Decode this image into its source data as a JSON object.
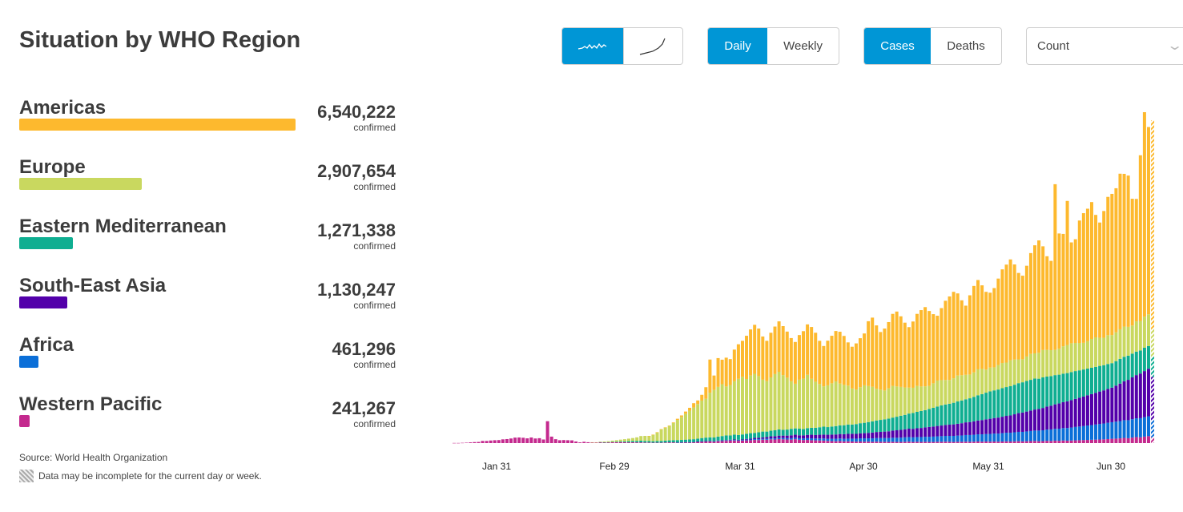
{
  "title": "Situation by WHO Region",
  "controls": {
    "chart_style": [
      {
        "icon": "daily-wave-icon",
        "active": true
      },
      {
        "icon": "cumulative-curve-icon",
        "active": false
      }
    ],
    "period": [
      {
        "label": "Daily",
        "active": true
      },
      {
        "label": "Weekly",
        "active": false
      }
    ],
    "metric": [
      {
        "label": "Cases",
        "active": true
      },
      {
        "label": "Deaths",
        "active": false
      }
    ],
    "scale_select": {
      "value": "Count"
    }
  },
  "regions": [
    {
      "name": "Americas",
      "value": "6,540,222",
      "count": 6540222,
      "sub": "confirmed",
      "color": "#FDB92E"
    },
    {
      "name": "Europe",
      "value": "2,907,654",
      "count": 2907654,
      "sub": "confirmed",
      "color": "#C9D85F"
    },
    {
      "name": "Eastern Mediterranean",
      "value": "1,271,338",
      "count": 1271338,
      "sub": "confirmed",
      "color": "#0FAE91"
    },
    {
      "name": "South-East Asia",
      "value": "1,130,247",
      "count": 1130247,
      "sub": "confirmed",
      "color": "#5300AA"
    },
    {
      "name": "Africa",
      "value": "461,296",
      "count": 461296,
      "sub": "confirmed",
      "color": "#0B6FD8"
    },
    {
      "name": "Western Pacific",
      "value": "241,267",
      "count": 241267,
      "sub": "confirmed",
      "color": "#C4298E"
    }
  ],
  "source": "Source: World Health Organization",
  "note": "Data may be incomplete for the current day or week.",
  "chart_data": {
    "type": "bar",
    "stacked": true,
    "x_start": "2020-01-20",
    "x_end": "2020-07-10",
    "x_ticks": [
      "Jan 31",
      "Feb 29",
      "Mar 31",
      "Apr 30",
      "May 31",
      "Jun 30"
    ],
    "incomplete_last": true,
    "grid": false,
    "series": [
      {
        "name": "Western Pacific",
        "color": "#C4298E",
        "values": [
          0.1,
          0.1,
          0.2,
          0.3,
          0.5,
          0.7,
          0.8,
          1.5,
          1.5,
          1.8,
          2.0,
          2.1,
          2.6,
          2.8,
          3.2,
          3.8,
          3.9,
          3.7,
          3.3,
          3.9,
          3.2,
          3.4,
          2.5,
          15.2,
          4.5,
          2.7,
          2.0,
          2.1,
          2.0,
          1.9,
          1.1,
          0.5,
          0.9,
          0.6,
          0.5,
          0.4,
          0.6,
          0.5,
          0.5,
          0.6,
          0.6,
          0.7,
          0.6,
          0.5,
          0.6,
          0.5,
          0.5,
          0.4,
          0.4,
          0.3,
          0.3,
          0.3,
          0.4,
          0.5,
          0.5,
          0.4,
          0.5,
          0.6,
          0.6,
          0.7,
          0.9,
          1.0,
          1.1,
          1.2,
          1.0,
          1.3,
          1.4,
          1.6,
          1.7,
          1.8,
          1.6,
          1.7,
          1.9,
          2.0,
          2.2,
          2.1,
          2.4,
          2.3,
          2.6,
          2.5,
          2.8,
          2.6,
          2.5,
          2.4,
          2.7,
          2.3,
          2.1,
          2.2,
          2.0,
          1.9,
          1.8,
          1.7,
          1.5,
          1.4,
          1.3,
          1.4,
          1.2,
          1.2,
          1.1,
          1.0,
          1.1,
          1.0,
          1.0,
          0.9,
          1.0,
          0.9,
          0.9,
          0.8,
          0.9,
          0.8,
          0.8,
          0.9,
          1.0,
          0.8,
          0.9,
          0.8,
          0.9,
          0.8,
          0.8,
          0.9,
          0.9,
          1.0,
          0.9,
          0.8,
          0.9,
          0.9,
          1.0,
          0.9,
          1.0,
          1.1,
          1.0,
          1.1,
          1.0,
          1.1,
          1.0,
          1.1,
          1.2,
          1.1,
          1.2,
          1.3,
          1.2,
          1.3,
          1.4,
          1.5,
          1.3,
          1.4,
          1.6,
          1.5,
          1.7,
          1.6,
          1.8,
          1.7,
          1.8,
          1.9,
          2.0,
          2.1,
          2.2,
          2.3,
          2.4,
          2.5,
          2.6,
          2.8,
          3.0,
          3.1,
          3.3,
          3.6,
          3.4,
          3.8,
          4.2,
          4.0,
          4.5,
          4.8,
          4.0
        ]
      },
      {
        "name": "Africa",
        "color": "#0B6FD8",
        "values": [
          0,
          0,
          0,
          0,
          0,
          0,
          0,
          0,
          0,
          0,
          0,
          0,
          0,
          0,
          0,
          0,
          0,
          0,
          0,
          0,
          0,
          0,
          0,
          0,
          0,
          0,
          0,
          0,
          0,
          0,
          0,
          0,
          0,
          0,
          0,
          0,
          0,
          0,
          0,
          0,
          0,
          0,
          0,
          0,
          0,
          0,
          0,
          0,
          0,
          0,
          0,
          0,
          0,
          0,
          0,
          0.1,
          0.1,
          0.1,
          0.1,
          0.1,
          0.1,
          0.2,
          0.2,
          0.2,
          0.2,
          0.3,
          0.3,
          0.3,
          0.3,
          0.4,
          0.4,
          0.4,
          0.5,
          0.5,
          0.6,
          0.6,
          0.6,
          0.7,
          0.7,
          0.8,
          0.8,
          0.9,
          0.9,
          1.0,
          1.0,
          1.1,
          1.1,
          1.2,
          1.3,
          1.3,
          1.4,
          1.5,
          1.5,
          1.6,
          1.7,
          1.8,
          1.8,
          1.9,
          2.0,
          2.1,
          2.2,
          2.3,
          2.3,
          2.4,
          2.5,
          2.6,
          2.6,
          2.7,
          2.8,
          2.9,
          3.0,
          3.1,
          3.2,
          3.2,
          3.3,
          3.4,
          3.5,
          3.6,
          3.7,
          3.8,
          3.9,
          4.0,
          4.1,
          4.2,
          4.3,
          4.4,
          4.6,
          4.7,
          4.8,
          5.0,
          5.1,
          5.2,
          5.4,
          5.5,
          5.6,
          5.8,
          6.0,
          6.1,
          6.3,
          6.5,
          6.6,
          6.8,
          7.0,
          7.2,
          7.4,
          7.5,
          7.8,
          8.0,
          8.2,
          8.4,
          8.6,
          8.8,
          9.0,
          9.3,
          9.5,
          9.7,
          10.0,
          10.2,
          10.5,
          10.8,
          11.0,
          11.3,
          11.5,
          11.8,
          12.0,
          12.3,
          12.5,
          12.8,
          13.0,
          13.3,
          13.5,
          13.8,
          12.0
        ]
      },
      {
        "name": "South-East Asia",
        "color": "#5300AA",
        "values": [
          0,
          0,
          0,
          0,
          0,
          0,
          0,
          0,
          0,
          0,
          0,
          0,
          0,
          0,
          0,
          0,
          0,
          0,
          0,
          0,
          0,
          0,
          0,
          0,
          0,
          0,
          0,
          0,
          0,
          0,
          0,
          0,
          0,
          0,
          0,
          0,
          0,
          0,
          0,
          0,
          0,
          0,
          0,
          0,
          0,
          0,
          0,
          0,
          0,
          0,
          0,
          0,
          0,
          0,
          0,
          0,
          0,
          0,
          0,
          0,
          0.1,
          0.1,
          0.1,
          0.1,
          0.1,
          0.2,
          0.2,
          0.2,
          0.3,
          0.3,
          0.3,
          0.4,
          0.5,
          0.6,
          0.8,
          0.9,
          1.0,
          1.2,
          1.4,
          1.5,
          1.6,
          1.7,
          1.8,
          2.0,
          2.1,
          2.0,
          2.2,
          2.3,
          2.5,
          2.4,
          2.6,
          2.7,
          2.8,
          2.9,
          3.0,
          3.1,
          3.2,
          3.3,
          3.4,
          3.3,
          3.5,
          3.6,
          3.8,
          4.0,
          4.2,
          4.3,
          4.5,
          4.7,
          5.0,
          5.2,
          5.4,
          5.6,
          5.8,
          5.9,
          6.1,
          6.3,
          6.5,
          6.8,
          7.0,
          7.2,
          7.4,
          7.6,
          7.8,
          8.0,
          8.2,
          8.5,
          8.8,
          9.0,
          9.3,
          9.6,
          9.9,
          10.2,
          10.5,
          10.8,
          11.1,
          11.4,
          11.7,
          12.0,
          12.5,
          13.0,
          13.4,
          13.8,
          14.2,
          14.6,
          15.0,
          15.5,
          16.0,
          16.5,
          17.0,
          17.5,
          18.0,
          18.5,
          19.0,
          19.5,
          20.0,
          20.5,
          21.0,
          21.5,
          22.0,
          22.5,
          23.0,
          23.5,
          24.0,
          25.0,
          26.0,
          27.0,
          28.0,
          29.0,
          30.0,
          31.0,
          32.0,
          33.0,
          30.0
        ]
      },
      {
        "name": "Eastern Mediterranean",
        "color": "#0FAE91",
        "values": [
          0,
          0,
          0,
          0,
          0,
          0,
          0,
          0,
          0,
          0,
          0,
          0,
          0,
          0,
          0,
          0,
          0,
          0,
          0,
          0,
          0,
          0,
          0,
          0,
          0,
          0,
          0,
          0,
          0,
          0,
          0,
          0,
          0,
          0,
          0,
          0,
          0.1,
          0.1,
          0.2,
          0.3,
          0.4,
          0.5,
          0.6,
          0.8,
          0.9,
          1.0,
          1.2,
          1.1,
          1.0,
          1.0,
          1.1,
          1.2,
          1.3,
          1.4,
          1.5,
          1.6,
          1.6,
          1.7,
          1.8,
          1.9,
          2.0,
          2.2,
          2.4,
          2.5,
          2.6,
          2.7,
          3.0,
          3.2,
          3.0,
          3.4,
          3.3,
          3.5,
          3.6,
          3.8,
          3.5,
          3.9,
          4.0,
          3.8,
          3.9,
          4.1,
          4.3,
          4.0,
          4.2,
          4.5,
          4.4,
          4.6,
          4.3,
          4.7,
          4.8,
          5.0,
          5.2,
          5.5,
          5.3,
          5.6,
          5.8,
          6.0,
          6.2,
          6.5,
          6.4,
          6.8,
          7.0,
          7.2,
          7.5,
          7.8,
          8.0,
          8.3,
          8.5,
          8.8,
          9.0,
          9.4,
          9.8,
          10.0,
          10.5,
          11.0,
          11.4,
          11.8,
          12.0,
          12.5,
          13.0,
          13.5,
          14.0,
          14.2,
          14.5,
          15.0,
          15.5,
          15.8,
          16.0,
          16.5,
          17.0,
          17.5,
          18.0,
          18.5,
          19.0,
          19.2,
          19.5,
          19.8,
          20.0,
          20.3,
          20.5,
          20.8,
          21.0,
          21.2,
          21.3,
          21.5,
          21.0,
          21.2,
          20.8,
          20.5,
          20.3,
          20.0,
          19.8,
          19.6,
          19.5,
          19.3,
          19.0,
          18.8,
          18.5,
          18.3,
          18.0,
          17.8,
          17.5,
          17.3,
          17.0,
          17.0,
          17.2,
          17.0,
          16.8,
          16.5,
          16.3,
          16.0,
          16.2,
          15.8,
          14.0
        ]
      },
      {
        "name": "Europe",
        "color": "#C9D85F",
        "values": [
          0,
          0,
          0,
          0,
          0,
          0,
          0,
          0,
          0,
          0,
          0,
          0,
          0,
          0,
          0,
          0,
          0,
          0,
          0,
          0,
          0,
          0,
          0,
          0,
          0,
          0,
          0,
          0,
          0,
          0,
          0,
          0,
          0,
          0,
          0.1,
          0.2,
          0.3,
          0.5,
          0.6,
          0.8,
          1.0,
          1.2,
          1.5,
          1.8,
          2.0,
          2.5,
          3.2,
          3.5,
          3.5,
          4.5,
          6.0,
          8.0,
          9.0,
          10.0,
          12.0,
          14.0,
          16.0,
          18.0,
          20.0,
          22.0,
          24.0,
          26.0,
          27.0,
          31.0,
          33.0,
          34.5,
          36.0,
          34.0,
          35.0,
          37.0,
          39.0,
          40.0,
          38.0,
          40.0,
          41.0,
          39.0,
          36.0,
          35.0,
          37.0,
          39.0,
          40.0,
          38.0,
          36.0,
          33.0,
          31.0,
          34.0,
          35.0,
          37.0,
          34.0,
          32.0,
          30.0,
          28.0,
          29.0,
          30.0,
          31.0,
          29.0,
          28.0,
          27.0,
          25.0,
          24.0,
          25.0,
          26.0,
          25.0,
          24.0,
          22.0,
          21.0,
          20.0,
          21.0,
          22.0,
          21.0,
          20.0,
          19.0,
          18.0,
          17.5,
          18.0,
          17.0,
          16.5,
          16.0,
          17.0,
          18.0,
          17.5,
          17.0,
          16.5,
          17.0,
          18.0,
          17.5,
          17.0,
          16.5,
          17.0,
          18.0,
          17.5,
          16.0,
          16.5,
          16.0,
          17.0,
          17.5,
          17.0,
          18.0,
          17.5,
          16.5,
          16.0,
          17.0,
          18.0,
          17.5,
          18.0,
          19.0,
          18.5,
          18.0,
          17.5,
          18.0,
          19.0,
          19.5,
          20.0,
          19.5,
          19.0,
          18.5,
          19.0,
          20.0,
          20.5,
          19.5,
          19.0,
          20.0,
          19.5,
          20.0,
          20.5,
          21.0,
          20.0,
          19.5,
          21.0,
          20.5,
          21.5,
          22.0,
          19.0
        ]
      },
      {
        "name": "Americas",
        "color": "#FDB92E",
        "values": [
          0,
          0,
          0,
          0,
          0,
          0,
          0,
          0,
          0,
          0,
          0,
          0,
          0,
          0,
          0,
          0,
          0,
          0,
          0,
          0,
          0,
          0,
          0,
          0,
          0,
          0,
          0,
          0,
          0,
          0,
          0,
          0,
          0,
          0,
          0,
          0,
          0,
          0,
          0,
          0,
          0,
          0,
          0,
          0,
          0,
          0,
          0,
          0,
          0.1,
          0.1,
          0.2,
          0.2,
          0.3,
          0.3,
          0.4,
          0.8,
          1.0,
          1.5,
          2.0,
          3.0,
          2.5,
          4.0,
          8.0,
          23.0,
          10.0,
          20.0,
          17.0,
          20.0,
          18.0,
          22.0,
          24.0,
          25.0,
          30,
          32,
          34,
          33,
          30,
          28,
          31,
          33,
          35,
          34,
          32,
          30,
          29,
          31,
          33,
          35,
          36,
          34,
          30,
          28,
          31,
          33,
          35,
          36,
          34,
          30,
          29,
          32,
          34,
          36,
          45,
          48,
          44,
          40,
          43,
          46,
          50,
          52,
          49,
          45,
          42,
          46,
          50,
          53,
          55,
          52,
          48,
          45,
          50,
          55,
          58,
          60,
          57,
          52,
          48,
          55,
          60,
          62,
          58,
          54,
          52,
          55,
          60,
          65,
          68,
          70,
          66,
          60,
          58,
          63,
          70,
          75,
          78,
          72,
          65,
          62,
          115,
          80,
          78,
          100,
          70,
          72,
          85,
          90,
          92,
          95,
          85,
          80,
          88,
          96,
          98,
          100,
          108,
          106,
          105,
          88,
          85,
          115,
          142,
          130,
          145
        ]
      }
    ]
  }
}
